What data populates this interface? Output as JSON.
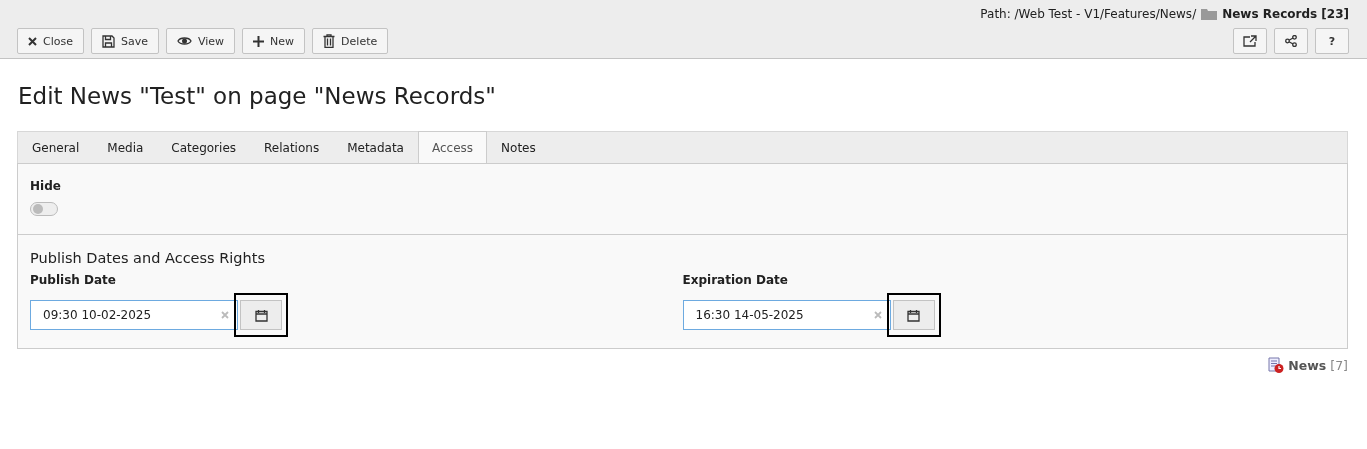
{
  "header": {
    "path_label": "Path: /Web Test - V1/Features/News/",
    "page_title": "News Records [23]"
  },
  "toolbar": {
    "buttons": [
      {
        "label": "Close"
      },
      {
        "label": "Save"
      },
      {
        "label": "View"
      },
      {
        "label": "New"
      },
      {
        "label": "Delete"
      }
    ],
    "right_buttons": [
      {
        "kind": "external"
      },
      {
        "kind": "share"
      },
      {
        "kind": "help",
        "label": "?"
      }
    ]
  },
  "title": "Edit News \"Test\" on page \"News Records\"",
  "tabs": [
    {
      "label": "General",
      "selected": false
    },
    {
      "label": "Media",
      "selected": false
    },
    {
      "label": "Categories",
      "selected": false
    },
    {
      "label": "Relations",
      "selected": false
    },
    {
      "label": "Metadata",
      "selected": false
    },
    {
      "label": "Access",
      "selected": true
    },
    {
      "label": "Notes",
      "selected": false
    }
  ],
  "hide": {
    "label": "Hide",
    "on": false
  },
  "section": {
    "title": "Publish Dates and Access Rights",
    "fields": [
      {
        "label": "Publish Date",
        "value": "09:30 10-02-2025",
        "highlighted": true
      },
      {
        "label": "Expiration Date",
        "value": "16:30 14-05-2025",
        "highlighted": true
      }
    ]
  },
  "footer": {
    "label": "News",
    "count": "[7]"
  }
}
